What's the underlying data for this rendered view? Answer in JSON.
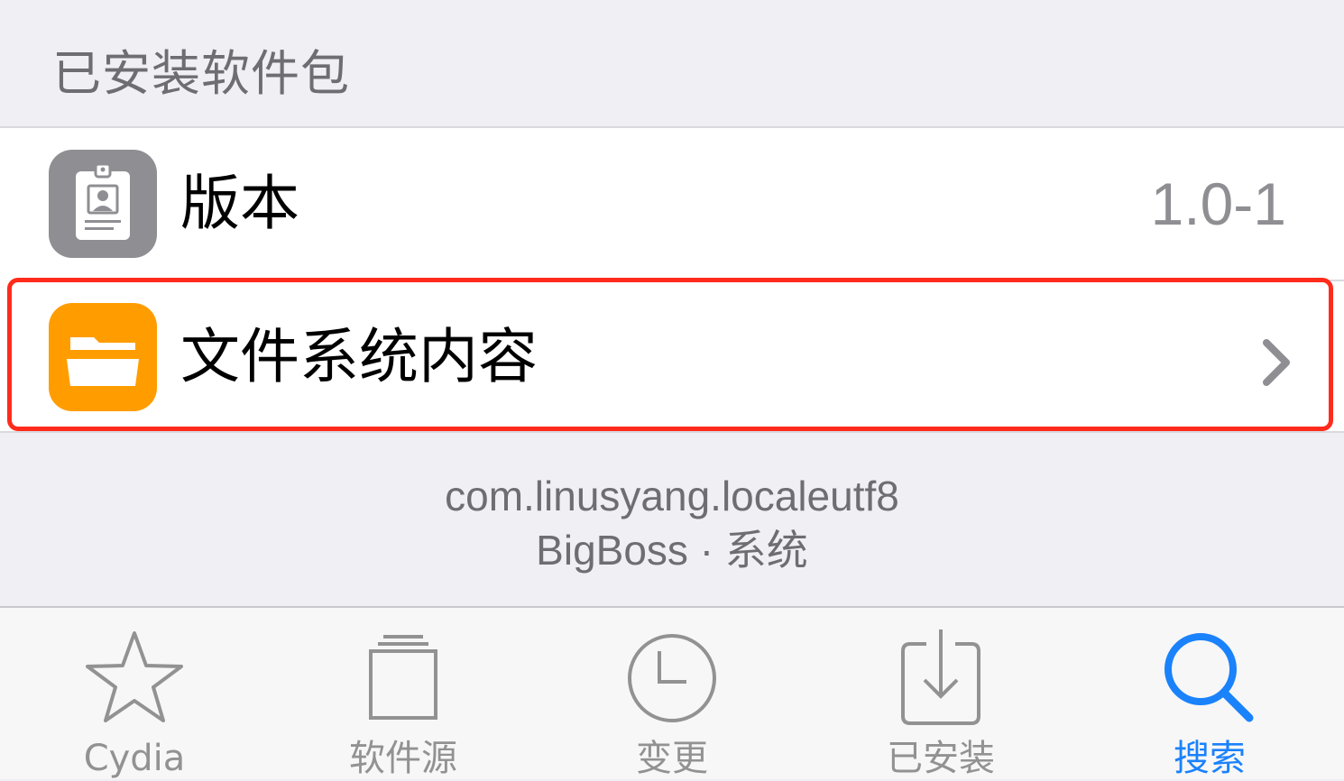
{
  "section": {
    "title": "已安装软件包"
  },
  "rows": [
    {
      "label": "版本",
      "value": "1.0-1",
      "icon": "id-card-icon",
      "icon_color": "#8e8e93"
    },
    {
      "label": "文件系统内容",
      "icon": "folder-icon",
      "icon_color": "#ff9d00",
      "accessory": "chevron-right-icon",
      "highlighted": true
    }
  ],
  "package": {
    "identifier": "com.linusyang.localeutf8",
    "source_section": "BigBoss · 系统"
  },
  "tabbar": {
    "active_color": "#1a82fb",
    "inactive_color": "#929292",
    "tabs": [
      {
        "label": "Cydia",
        "icon": "star-icon",
        "active": false
      },
      {
        "label": "软件源",
        "icon": "stack-icon",
        "active": false
      },
      {
        "label": "变更",
        "icon": "clock-icon",
        "active": false
      },
      {
        "label": "已安装",
        "icon": "download-tray-icon",
        "active": false
      },
      {
        "label": "搜索",
        "icon": "search-icon",
        "active": true
      }
    ]
  },
  "colors": {
    "highlight_border": "#ff2b1c",
    "background": "#efeff4"
  }
}
